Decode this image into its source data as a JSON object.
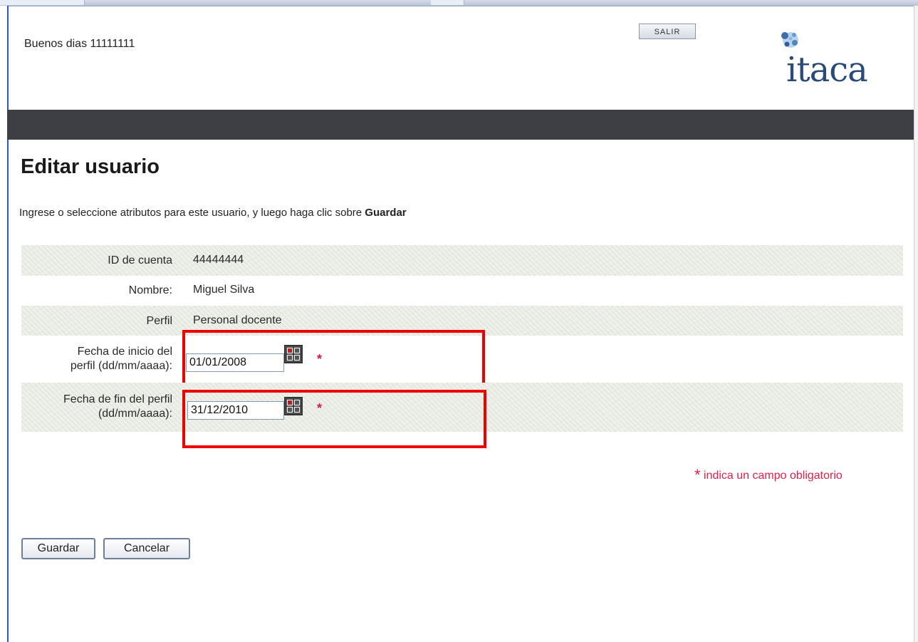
{
  "header": {
    "greeting": "Buenos dias 11111111",
    "logout_label": "SALIR",
    "logo_text": "itaca"
  },
  "page": {
    "title": "Editar usuario",
    "instructions_prefix": "Ingrese o seleccione atributos para este usuario, y luego haga clic sobre ",
    "instructions_bold": "Guardar"
  },
  "form": {
    "account_id": {
      "label": "ID de cuenta",
      "value": "44444444"
    },
    "name": {
      "label": "Nombre:",
      "value": "Miguel Silva"
    },
    "profile": {
      "label": "Perfil",
      "value": "Personal docente"
    },
    "start_date": {
      "label_line1": "Fecha de inicio del",
      "label_line2": "perfil (dd/mm/aaaa):",
      "value": "01/01/2008",
      "required_mark": "*"
    },
    "end_date": {
      "label_line1": "Fecha de fin del perfil",
      "label_line2": "(dd/mm/aaaa):",
      "value": "31/12/2010",
      "required_mark": "*"
    }
  },
  "required_note": {
    "star": "*",
    "text": "indica un campo obligatorio"
  },
  "buttons": {
    "save_label": "Guardar",
    "cancel_label": "Cancelar"
  },
  "colors": {
    "header_bar": "#3e3f45",
    "highlight_box": "#ee0000",
    "required_text": "#e0204a",
    "logo_text": "#2a4a7a"
  }
}
